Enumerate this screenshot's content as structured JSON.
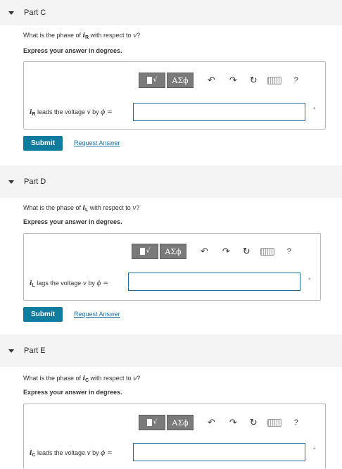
{
  "parts": [
    {
      "title": "Part C",
      "question_prefix": "What is the phase of ",
      "current_symbol": "i",
      "current_sub": "R",
      "question_middle": " with respect to ",
      "voltage_symbol": "v",
      "question_suffix": "?",
      "instruction": "Express your answer in degrees.",
      "answer_label_middle": " leads the voltage ",
      "answer_label_by": " by ",
      "phi": "ϕ =",
      "answer_value": "",
      "unit": "°",
      "submit_label": "Submit",
      "request_label": "Request Answer"
    },
    {
      "title": "Part D",
      "question_prefix": "What is the phase of ",
      "current_symbol": "i",
      "current_sub": "L",
      "question_middle": " with respect to ",
      "voltage_symbol": "v",
      "question_suffix": "?",
      "instruction": "Express your answer in degrees.",
      "answer_label_middle": " lags the voltage ",
      "answer_label_by": " by ",
      "phi": "ϕ =",
      "answer_value": "",
      "unit": "°",
      "submit_label": "Submit",
      "request_label": "Request Answer"
    },
    {
      "title": "Part E",
      "question_prefix": "What is the phase of ",
      "current_symbol": "i",
      "current_sub": "C",
      "question_middle": " with respect to ",
      "voltage_symbol": "v",
      "question_suffix": "?",
      "instruction": "Express your answer in degrees.",
      "answer_label_middle": " leads the voltage ",
      "answer_label_by": " by ",
      "phi": "ϕ =",
      "answer_value": "",
      "unit": "°"
    }
  ],
  "toolbar": {
    "templates_icon": "templates-icon",
    "symbols_label": "ΑΣϕ",
    "undo_icon": "undo-icon",
    "undo_glyph": "↶",
    "redo_icon": "redo-icon",
    "redo_glyph": "↷",
    "reset_icon": "reset-icon",
    "reset_glyph": "↻",
    "keyboard_icon": "keyboard-icon",
    "help_label": "?"
  }
}
